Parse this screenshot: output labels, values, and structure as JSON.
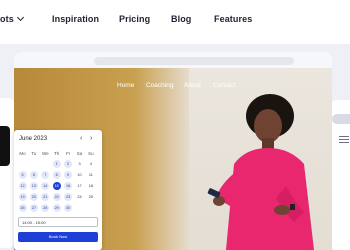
{
  "topnav": {
    "items": [
      {
        "label": "ots",
        "has_chevron": true
      },
      {
        "label": "Inspiration"
      },
      {
        "label": "Pricing"
      },
      {
        "label": "Blog"
      },
      {
        "label": "Features"
      }
    ]
  },
  "hero": {
    "nav": [
      "Home",
      "Coaching",
      "About",
      "Contact"
    ]
  },
  "calendar": {
    "month": "June 2023",
    "prev": "‹",
    "next": "›",
    "weekdays": [
      "Mo",
      "Tu",
      "We",
      "Th",
      "Fr",
      "Sa",
      "Su"
    ],
    "weeks": [
      [
        "",
        "",
        "",
        "1",
        "2",
        "3",
        "4"
      ],
      [
        "5",
        "6",
        "7",
        "8",
        "9",
        "10",
        "11"
      ],
      [
        "12",
        "13",
        "14",
        "15",
        "16",
        "17",
        "18"
      ],
      [
        "19",
        "20",
        "21",
        "22",
        "23",
        "24",
        "25"
      ],
      [
        "26",
        "27",
        "28",
        "29",
        "30",
        "",
        ""
      ]
    ],
    "selected_day": "15",
    "time_slot": "14:00 - 15:00",
    "book_label": "Book Now"
  },
  "colors": {
    "accent": "#1e40d6",
    "shirt": "#e8276f",
    "hero_gold": "#c9a050"
  }
}
